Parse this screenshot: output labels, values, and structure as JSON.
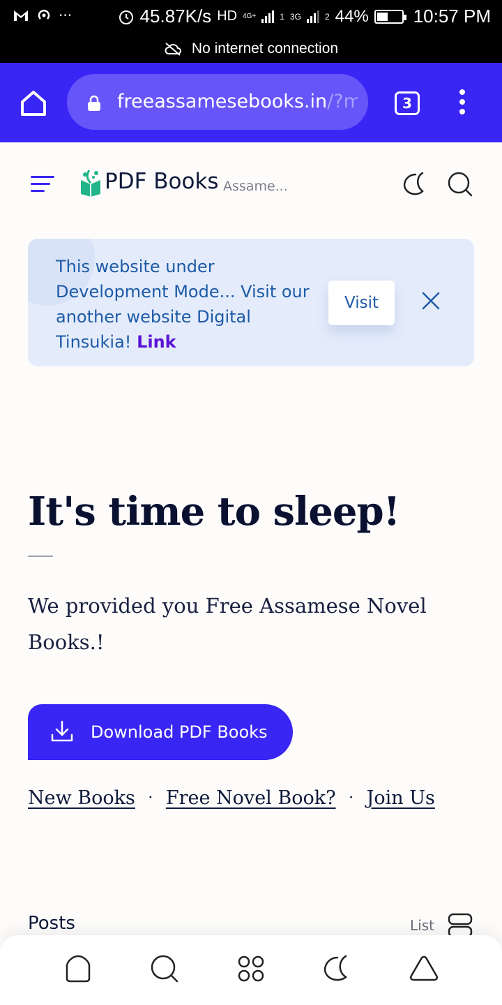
{
  "status_bar": {
    "net_speed": "45.87K/s",
    "hd_label": "HD",
    "network_4g": "4G+",
    "sim1": "1",
    "network_3g": "3G",
    "sim2": "2",
    "battery": "44%",
    "battery_level": 0.44,
    "time": "10:57 PM",
    "notice": "No internet connection",
    "overflow": "···"
  },
  "browser": {
    "url_main": "freeassamesebooks.in",
    "url_rest": "/?m",
    "tab_count": "3",
    "accent": "#3a26f4"
  },
  "site": {
    "brand": "PDF Books",
    "brand_sub": "Assame..."
  },
  "notice": {
    "text": "This website under Development Mode... Visit our another website Digital Tinsukia!",
    "link_label": "Link",
    "visit_label": "Visit"
  },
  "hero": {
    "title": "It's time to sleep!",
    "description": "We provided you Free Assamese Novel Books.!",
    "download_label": "Download PDF Books",
    "links": [
      "New Books",
      "Free Novel Book?",
      "Join Us"
    ],
    "separator": "·"
  },
  "posts": {
    "title": "Posts",
    "view_label": "List"
  },
  "bottom_nav": {
    "icons": [
      "home-icon",
      "search-icon",
      "grid-icon",
      "moon-icon",
      "triangle-icon"
    ]
  }
}
